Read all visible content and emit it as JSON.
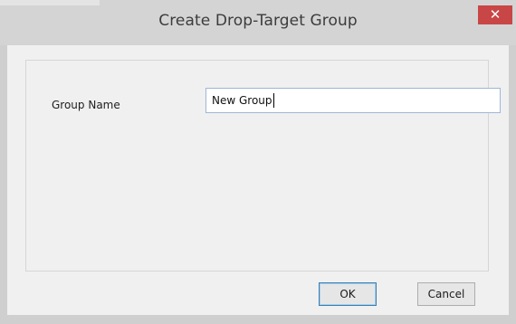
{
  "dialog": {
    "title": "Create Drop-Target Group",
    "close_glyph": "✕"
  },
  "form": {
    "group_name_label": "Group Name",
    "group_name_value": "New Group"
  },
  "buttons": {
    "ok_label": "OK",
    "cancel_label": "Cancel"
  },
  "colors": {
    "close_button_bg": "#c94646",
    "input_border": "#9fb6d6",
    "ok_button_border": "#3c7fb1"
  },
  "icons": {
    "close": "close-icon"
  }
}
